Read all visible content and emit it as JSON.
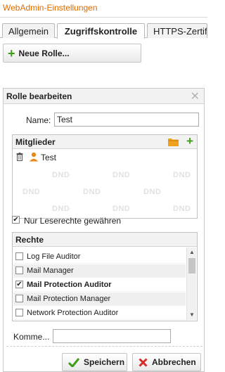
{
  "app": {
    "title": "WebAdmin-Einstellungen"
  },
  "tabs": [
    {
      "label": "Allgemein"
    },
    {
      "label": "Zugriffskontrolle"
    },
    {
      "label": "HTTPS-Zertifikat"
    }
  ],
  "toolbar": {
    "new_role_label": "Neue Rolle..."
  },
  "dialog": {
    "title": "Rolle bearbeiten",
    "name_label": "Name:",
    "name_value": "Test",
    "members": {
      "title": "Mitglieder",
      "items": [
        {
          "name": "Test"
        }
      ],
      "dnd_label": "DND"
    },
    "readonly_checkbox": {
      "label": "Nur Leserechte gewähren",
      "checked": true
    },
    "rights": {
      "title": "Rechte",
      "items": [
        {
          "label": "Log File Auditor",
          "checked": false
        },
        {
          "label": "Mail Manager",
          "checked": false
        },
        {
          "label": "Mail Protection Auditor",
          "checked": true
        },
        {
          "label": "Mail Protection Manager",
          "checked": false
        },
        {
          "label": "Network Protection Auditor",
          "checked": false
        }
      ]
    },
    "comment_label": "Komme...",
    "comment_value": "",
    "save_label": "Speichern",
    "cancel_label": "Abbrechen"
  },
  "colors": {
    "title_orange": "#e06c00",
    "plus_green": "#3f9b1a",
    "cancel_red": "#d32a2a",
    "folder_orange": "#f0a21c"
  },
  "icons": {
    "add": "plus-icon",
    "close": "close-icon",
    "folder": "folder-icon",
    "trash": "trash-icon",
    "user": "user-icon",
    "save": "checkmark-icon",
    "cancel": "x-icon"
  }
}
